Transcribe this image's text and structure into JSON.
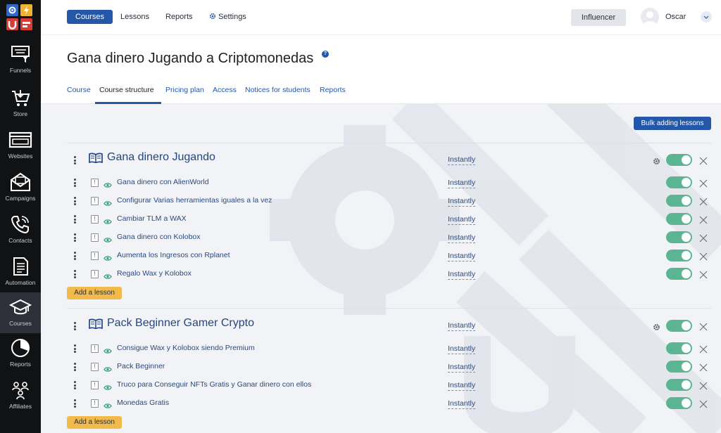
{
  "sidebar": {
    "items": [
      {
        "label": "Funnels",
        "icon": "funnel-icon"
      },
      {
        "label": "Store",
        "icon": "cart-icon"
      },
      {
        "label": "Websites",
        "icon": "browser-icon"
      },
      {
        "label": "Campaigns",
        "icon": "envelope-icon"
      },
      {
        "label": "Contacts",
        "icon": "phone-icon"
      },
      {
        "label": "Automation",
        "icon": "document-icon"
      },
      {
        "label": "Courses",
        "icon": "graduation-cap-icon",
        "active": true
      },
      {
        "label": "Reports",
        "icon": "pie-chart-icon"
      },
      {
        "label": "Affiliates",
        "icon": "people-icon"
      }
    ]
  },
  "topnav": {
    "items": [
      "Courses",
      "Lessons",
      "Reports",
      "Settings"
    ],
    "influencer": "Influencer",
    "user": "Oscar"
  },
  "page": {
    "title": "Gana dinero Jugando a Criptomonedas",
    "help": "?",
    "tabs": [
      "Course",
      "Course structure",
      "Pricing plan",
      "Access",
      "Notices for students",
      "Reports"
    ],
    "active_tab": "Course structure"
  },
  "main": {
    "bulk_button": "Bulk adding lessons",
    "add_lesson": "Add a lesson",
    "sections": [
      {
        "title": "Gana dinero Jugando",
        "release": "Instantly",
        "lessons": [
          {
            "title": "Gana dinero con AlienWorld",
            "release": "Instantly"
          },
          {
            "title": "Configurar Varias herramientas iguales a la vez",
            "release": "Instantly"
          },
          {
            "title": "Cambiar TLM a WAX",
            "release": "Instantly"
          },
          {
            "title": "Gana dinero con Kolobox",
            "release": "Instantly"
          },
          {
            "title": "Aumenta los Ingresos con Rplanet",
            "release": "Instantly"
          },
          {
            "title": "Regalo Wax y Kolobox",
            "release": "Instantly"
          }
        ]
      },
      {
        "title": "Pack Beginner Gamer Crypto",
        "release": "Instantly",
        "lessons": [
          {
            "title": "Consigue Wax y Kolobox siendo Premium",
            "release": "Instantly"
          },
          {
            "title": "Pack Beginner",
            "release": "Instantly"
          },
          {
            "title": "Truco para Conseguir NFTs Gratis y Ganar dinero con ellos",
            "release": "Instantly"
          },
          {
            "title": "Monedas Gratis",
            "release": "Instantly"
          }
        ]
      }
    ]
  },
  "colors": {
    "brand_blue": "#2457a7",
    "toggle_on": "#5cb592",
    "add_button": "#f2b94b",
    "sidebar_bg": "#111214"
  }
}
